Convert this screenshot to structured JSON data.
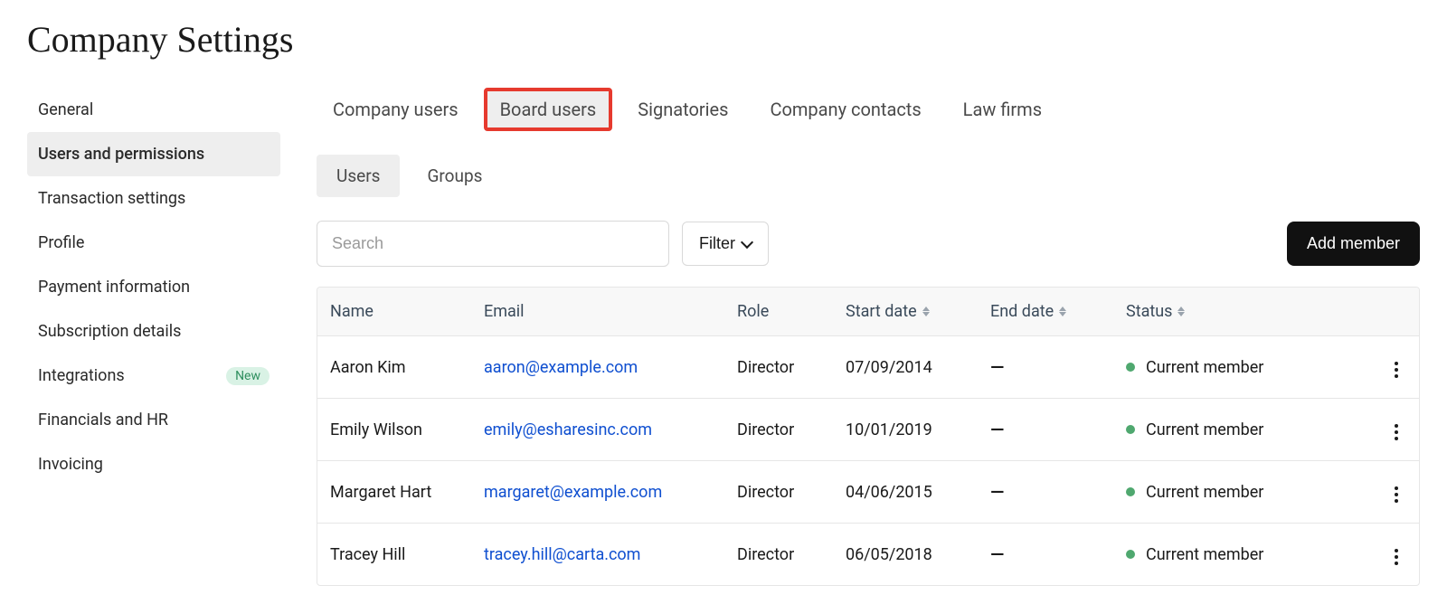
{
  "page_title": "Company Settings",
  "sidebar": {
    "items": [
      {
        "label": "General",
        "active": false
      },
      {
        "label": "Users and permissions",
        "active": true
      },
      {
        "label": "Transaction settings",
        "active": false
      },
      {
        "label": "Profile",
        "active": false
      },
      {
        "label": "Payment information",
        "active": false
      },
      {
        "label": "Subscription details",
        "active": false
      },
      {
        "label": "Integrations",
        "active": false,
        "badge": "New"
      },
      {
        "label": "Financials and HR",
        "active": false
      },
      {
        "label": "Invoicing",
        "active": false
      }
    ]
  },
  "top_tabs": [
    {
      "label": "Company users",
      "highlighted": false
    },
    {
      "label": "Board users",
      "highlighted": true
    },
    {
      "label": "Signatories",
      "highlighted": false
    },
    {
      "label": "Company contacts",
      "highlighted": false
    },
    {
      "label": "Law firms",
      "highlighted": false
    }
  ],
  "sub_tabs": [
    {
      "label": "Users",
      "active": true
    },
    {
      "label": "Groups",
      "active": false
    }
  ],
  "toolbar": {
    "search_placeholder": "Search",
    "filter_label": "Filter",
    "add_label": "Add member"
  },
  "table": {
    "columns": {
      "name": "Name",
      "email": "Email",
      "role": "Role",
      "start_date": "Start date",
      "end_date": "End date",
      "status": "Status"
    },
    "rows": [
      {
        "name": "Aaron Kim",
        "email": "aaron@example.com",
        "role": "Director",
        "start_date": "07/09/2014",
        "end_date": "—",
        "status": "Current member"
      },
      {
        "name": "Emily Wilson",
        "email": "emily@esharesinc.com",
        "role": "Director",
        "start_date": "10/01/2019",
        "end_date": "—",
        "status": "Current member"
      },
      {
        "name": "Margaret Hart",
        "email": "margaret@example.com",
        "role": "Director",
        "start_date": "04/06/2015",
        "end_date": "—",
        "status": "Current member"
      },
      {
        "name": "Tracey Hill",
        "email": "tracey.hill@carta.com",
        "role": "Director",
        "start_date": "06/05/2018",
        "end_date": "—",
        "status": "Current member"
      }
    ]
  }
}
